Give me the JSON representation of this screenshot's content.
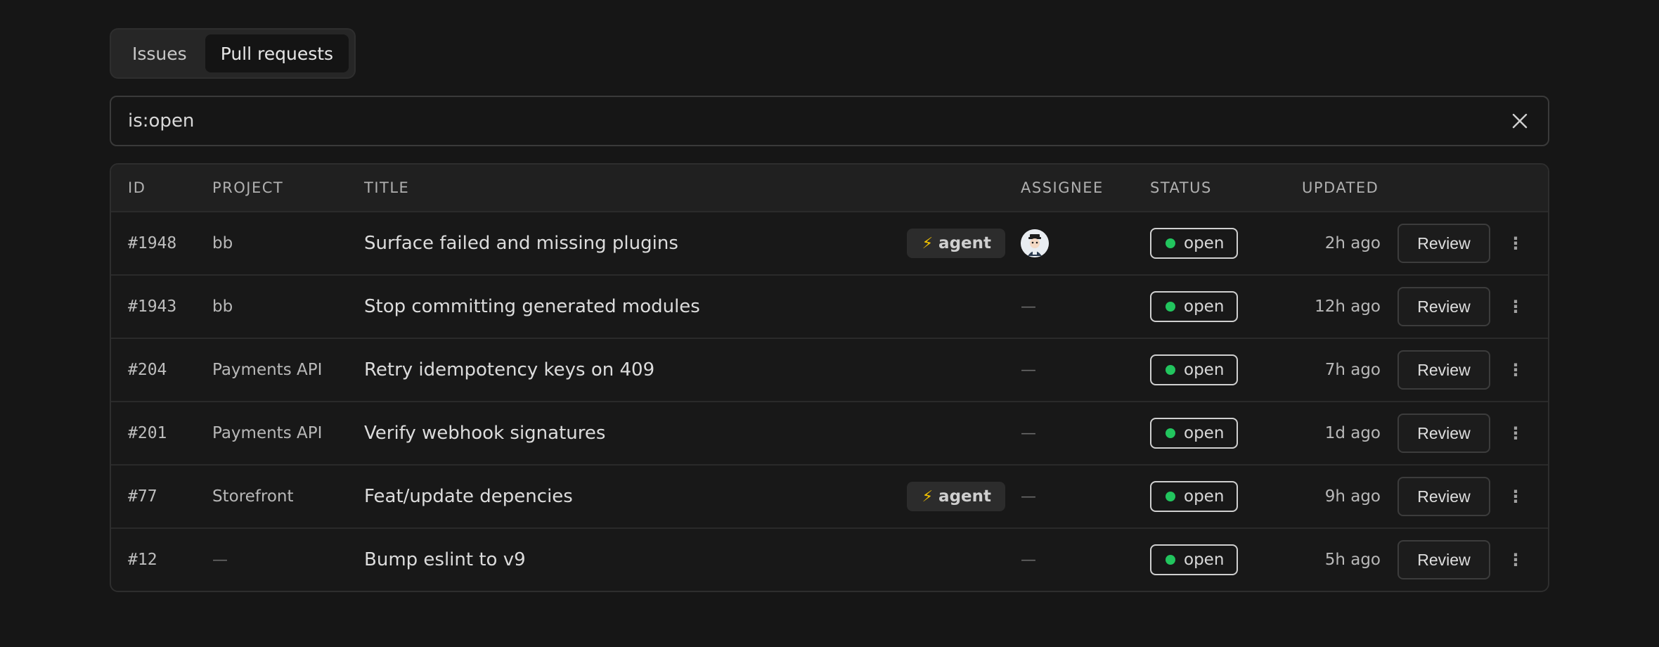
{
  "tabs": [
    {
      "label": "Issues",
      "active": false
    },
    {
      "label": "Pull requests",
      "active": true
    }
  ],
  "search": {
    "value": "is:open",
    "clear_icon": "close-icon"
  },
  "table": {
    "headers": {
      "id": "ID",
      "project": "PROJECT",
      "title": "TITLE",
      "assignee": "ASSIGNEE",
      "status": "STATUS",
      "updated": "UPDATED"
    },
    "rows": [
      {
        "id": "#1948",
        "project": "bb",
        "title": "Surface failed and missing plugins",
        "tag": "agent",
        "assignee": "avatar",
        "status": "open",
        "updated": "2h ago",
        "action": "Review"
      },
      {
        "id": "#1943",
        "project": "bb",
        "title": "Stop committing generated modules",
        "tag": "",
        "assignee": "—",
        "status": "open",
        "updated": "12h ago",
        "action": "Review"
      },
      {
        "id": "#204",
        "project": "Payments API",
        "title": "Retry idempotency keys on 409",
        "tag": "",
        "assignee": "—",
        "status": "open",
        "updated": "7h ago",
        "action": "Review"
      },
      {
        "id": "#201",
        "project": "Payments API",
        "title": "Verify webhook signatures",
        "tag": "",
        "assignee": "—",
        "status": "open",
        "updated": "1d ago",
        "action": "Review"
      },
      {
        "id": "#77",
        "project": "Storefront",
        "title": "Feat/update depencies",
        "tag": "agent",
        "assignee": "—",
        "status": "open",
        "updated": "9h ago",
        "action": "Review"
      },
      {
        "id": "#12",
        "project": "—",
        "title": "Bump eslint to v9",
        "tag": "",
        "assignee": "—",
        "status": "open",
        "updated": "5h ago",
        "action": "Review"
      }
    ]
  },
  "tag_bolt": "⚡",
  "more_glyph": "⋮",
  "colors": {
    "background": "#161616",
    "status_open_dot": "#22c55e",
    "agent_bolt": "#f2c200"
  }
}
